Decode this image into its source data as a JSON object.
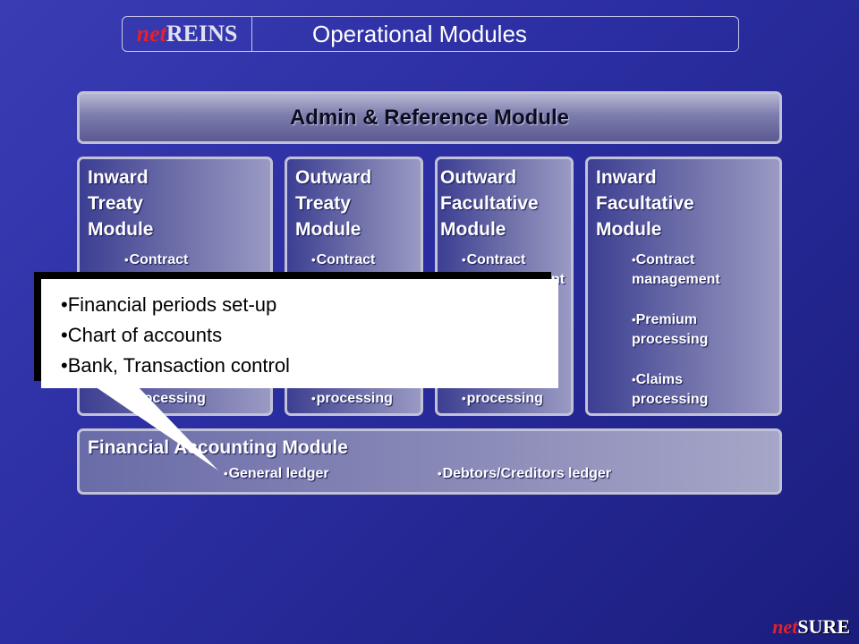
{
  "header": {
    "brand_prefix": "net",
    "brand_name": "REINS",
    "title": "Operational Modules"
  },
  "admin_module": {
    "title": "Admin & Reference Module"
  },
  "modules": [
    {
      "title": [
        "Inward",
        "Treaty",
        "Module"
      ],
      "bullets": [
        "Contract",
        "processing"
      ]
    },
    {
      "title": [
        "Outward",
        "Treaty",
        "Module"
      ],
      "bullets": [
        "Contract",
        "processing"
      ]
    },
    {
      "title": [
        "Outward",
        "Facultative",
        "Module"
      ],
      "bullets": [
        "Contract",
        "nt",
        "processing"
      ]
    },
    {
      "title": [
        "Inward",
        "Facultative",
        "Module"
      ],
      "bullets": [
        [
          "Contract",
          "management"
        ],
        [
          "Premium",
          "processing"
        ],
        [
          "Claims",
          "processing"
        ]
      ]
    }
  ],
  "financial_module": {
    "title": "Financial Accounting Module",
    "bullets": [
      "General ledger",
      "Debtors/Creditors ledger"
    ]
  },
  "callout": {
    "items": [
      "Financial periods set-up",
      "Chart of accounts",
      "Bank, Transaction control"
    ]
  },
  "footer": {
    "brand_prefix": "net",
    "brand_name": "SURE"
  },
  "colors": {
    "background": "#2a2da0",
    "brand_red": "#e8202a",
    "panel_border": "#c2c2d6"
  }
}
